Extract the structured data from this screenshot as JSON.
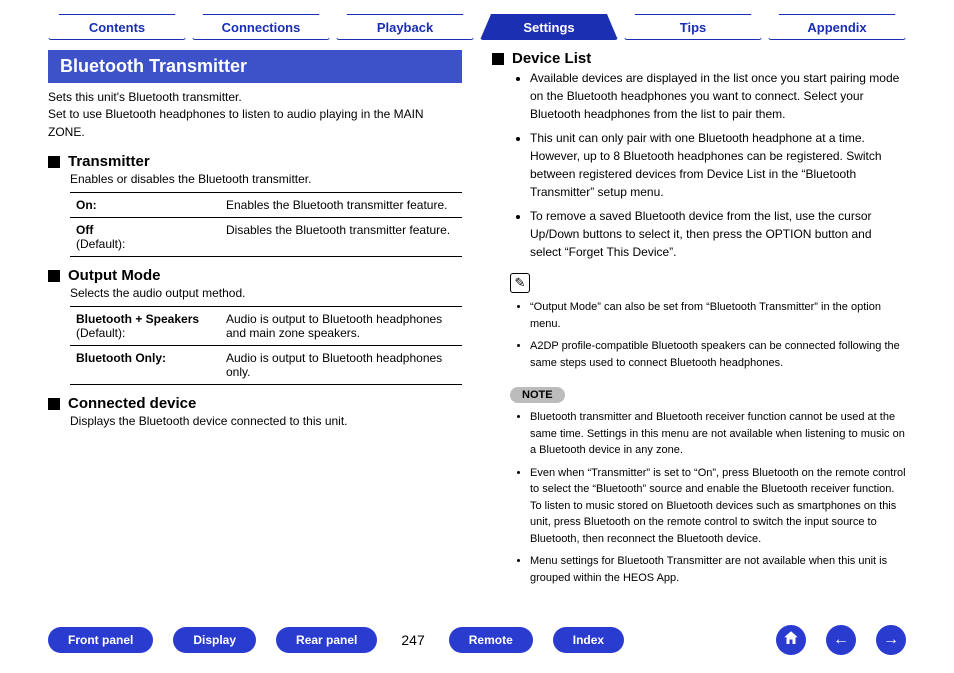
{
  "tabs": [
    "Contents",
    "Connections",
    "Playback",
    "Settings",
    "Tips",
    "Appendix"
  ],
  "active_tab": 3,
  "page_number": "247",
  "left": {
    "title": "Bluetooth Transmitter",
    "intro": "Sets this unit's Bluetooth transmitter.\nSet to use Bluetooth headphones to listen to audio playing in the MAIN ZONE.",
    "sections": {
      "transmitter": {
        "heading": "Transmitter",
        "sub": "Enables or disables the Bluetooth transmitter.",
        "rows": [
          {
            "k": "On:",
            "def": "",
            "v": "Enables the Bluetooth transmitter feature."
          },
          {
            "k": "Off",
            "def": "(Default):",
            "v": "Disables the Bluetooth transmitter feature."
          }
        ]
      },
      "output_mode": {
        "heading": "Output Mode",
        "sub": "Selects the audio output method.",
        "rows": [
          {
            "k": "Bluetooth + Speakers",
            "def": "(Default):",
            "v": "Audio is output to Bluetooth headphones and main zone speakers."
          },
          {
            "k": "Bluetooth Only:",
            "def": "",
            "v": "Audio is output to Bluetooth headphones only."
          }
        ]
      },
      "connected": {
        "heading": "Connected device",
        "sub": "Displays the Bluetooth device connected to this unit."
      }
    }
  },
  "right": {
    "device_list": {
      "heading": "Device List",
      "items": [
        "Available devices are displayed in the list once you start pairing mode on the Bluetooth headphones you want to connect. Select your Bluetooth headphones from the list to pair them.",
        "This unit can only pair with one Bluetooth headphone at a time. However, up to 8 Bluetooth headphones can be registered. Switch between registered devices from Device List in the “Bluetooth Transmitter” setup menu.",
        "To remove a saved Bluetooth device from the list, use the cursor Up/Down buttons to select it, then press the OPTION button and select “Forget This Device”."
      ]
    },
    "tips": [
      "“Output Mode” can also be set from “Bluetooth Transmitter” in the option menu.",
      "A2DP profile-compatible Bluetooth speakers can be connected following the same steps used to connect Bluetooth headphones."
    ],
    "note_label": "NOTE",
    "notes": [
      "Bluetooth transmitter and Bluetooth receiver function cannot be used at the same time. Settings in this menu are not available when listening to music on a Bluetooth device in any zone.",
      "Even when “Transmitter” is set to “On”, press Bluetooth on the remote control to select the “Bluetooth” source and enable the Bluetooth receiver function.\nTo listen to music stored on Bluetooth devices such as smartphones on this unit, press Bluetooth on the remote control to switch the input source to Bluetooth, then reconnect the Bluetooth device.",
      "Menu settings for Bluetooth Transmitter are not available when this unit is grouped within the HEOS App."
    ]
  },
  "bottom": {
    "buttons": [
      "Front panel",
      "Display",
      "Rear panel",
      "Remote",
      "Index"
    ]
  }
}
